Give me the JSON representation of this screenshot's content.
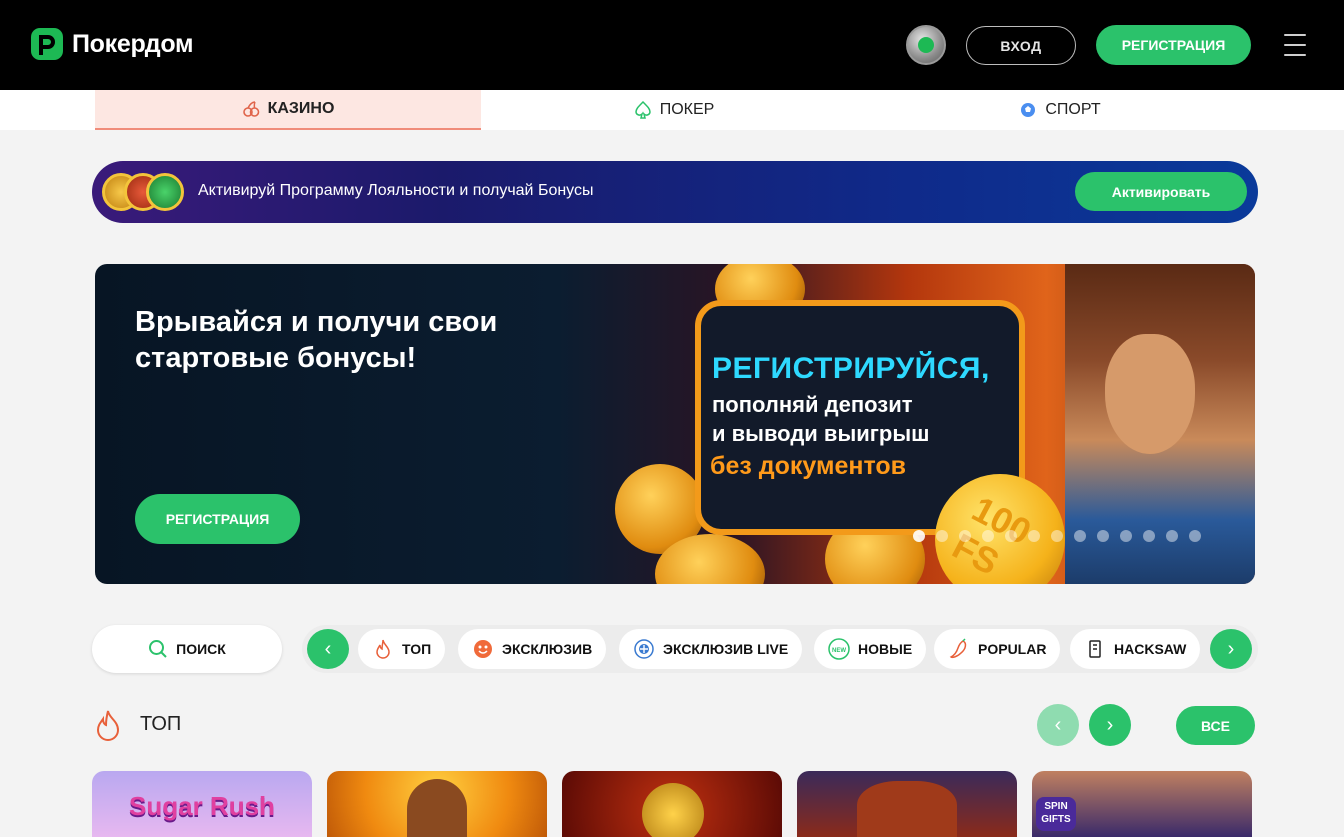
{
  "header": {
    "logo_text": "Покердом",
    "login_label": "ВХОД",
    "register_label": "РЕГИСТРАЦИЯ"
  },
  "tabs": [
    {
      "label": "КАЗИНО",
      "icon": "cherry-icon",
      "active": true
    },
    {
      "label": "ПОКЕР",
      "icon": "spade-icon",
      "active": false
    },
    {
      "label": "СПОРТ",
      "icon": "ball-icon",
      "active": false
    }
  ],
  "loyalty": {
    "text": "Активируй Программу Лояльности и получай Бонусы",
    "button_label": "Активировать"
  },
  "hero": {
    "title": "Врывайся и получи свои стартовые бонусы!",
    "button_label": "РЕГИСТРАЦИЯ",
    "promo_line1": "РЕГИСТРИРУЙСЯ,",
    "promo_line2": "пополняй депозит",
    "promo_line3": "и выводи выигрыш",
    "promo_line4": "без документов",
    "coin_text": "100 FS",
    "slides_count": 13,
    "active_slide": 1
  },
  "search": {
    "label": "ПОИСК"
  },
  "categories": [
    {
      "label": "ТОП",
      "icon": "flame-icon"
    },
    {
      "label": "ЭКСКЛЮЗИВ",
      "icon": "face-icon"
    },
    {
      "label": "ЭКСКЛЮЗИВ LIVE",
      "icon": "live-icon"
    },
    {
      "label": "НОВЫЕ",
      "icon": "new-badge-icon"
    },
    {
      "label": "POPULAR",
      "icon": "chili-icon"
    },
    {
      "label": "HACKSAW",
      "icon": "hacksaw-icon"
    }
  ],
  "top_section": {
    "title": "ТОП",
    "all_label": "ВСЕ"
  },
  "games": [
    {
      "label": "Sugar Rush"
    },
    {
      "label": ""
    },
    {
      "label": ""
    },
    {
      "label": ""
    },
    {
      "label": "SPIN GIFTS"
    }
  ],
  "colors": {
    "accent": "#2bc26b",
    "header_bg": "#000000",
    "active_tab_bg": "#fde7e2"
  }
}
